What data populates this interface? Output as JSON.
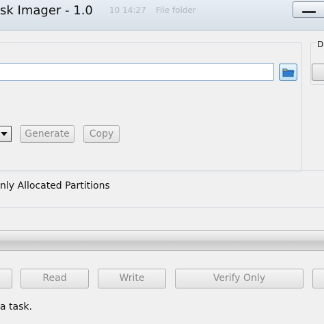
{
  "window": {
    "title": "sk Imager - 1.0",
    "ghost_text_1": "10 14:27",
    "ghost_text_2": "File folder"
  },
  "image_file": {
    "value": "",
    "placeholder": ""
  },
  "right_group_label": "D",
  "hash": {
    "generate_label": "Generate",
    "copy_label": "Copy"
  },
  "options": {
    "allocated_label": "nly Allocated Partitions"
  },
  "progress": {
    "fraction": 0
  },
  "actions": {
    "read_label": "Read",
    "write_label": "Write",
    "verify_label": "Verify Only"
  },
  "status": {
    "text": "a task."
  },
  "colors": {
    "button_text_disabled": "#8b8b8b",
    "browse_blue": "#3c7fb1"
  }
}
